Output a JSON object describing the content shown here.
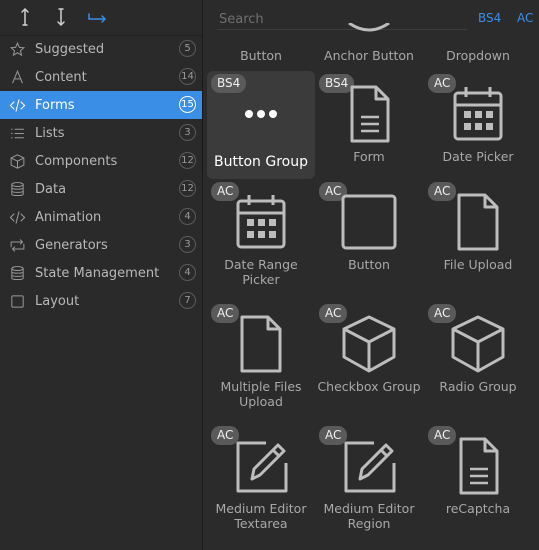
{
  "toolbar": {
    "tools": [
      "move-up-icon",
      "move-down-icon",
      "move-right-icon"
    ],
    "accent": "#3a8ee6"
  },
  "sidebar": {
    "items": [
      {
        "label": "Suggested",
        "count": "5",
        "icon": "star-icon"
      },
      {
        "label": "Content",
        "count": "14",
        "icon": "text-icon"
      },
      {
        "label": "Forms",
        "count": "15",
        "icon": "code-icon",
        "active": true
      },
      {
        "label": "Lists",
        "count": "3",
        "icon": "list-icon"
      },
      {
        "label": "Components",
        "count": "12",
        "icon": "cube-icon"
      },
      {
        "label": "Data",
        "count": "12",
        "icon": "database-icon"
      },
      {
        "label": "Animation",
        "count": "4",
        "icon": "code-icon"
      },
      {
        "label": "Generators",
        "count": "3",
        "icon": "loop-icon"
      },
      {
        "label": "State Management",
        "count": "4",
        "icon": "database-icon"
      },
      {
        "label": "Layout",
        "count": "7",
        "icon": "square-icon"
      }
    ]
  },
  "search": {
    "placeholder": "Search",
    "value": ""
  },
  "frameworks": {
    "bs4": "BS4",
    "ac": "AC"
  },
  "top_row_partial": [
    "Button",
    "Anchor Button",
    "Dropdown"
  ],
  "components": [
    {
      "name": "Button Group",
      "badge": "BS4",
      "icon": "dots-icon",
      "selected": true
    },
    {
      "name": "Form",
      "badge": "BS4",
      "icon": "document-icon"
    },
    {
      "name": "Date Picker",
      "badge": "AC",
      "icon": "calendar-icon"
    },
    {
      "name": "Date Range Picker",
      "badge": "AC",
      "icon": "calendar-icon"
    },
    {
      "name": "Button",
      "badge": "AC",
      "icon": "square-icon"
    },
    {
      "name": "File Upload",
      "badge": "AC",
      "icon": "file-icon"
    },
    {
      "name": "Multiple Files Upload",
      "badge": "AC",
      "icon": "file-icon"
    },
    {
      "name": "Checkbox Group",
      "badge": "AC",
      "icon": "cube-icon"
    },
    {
      "name": "Radio Group",
      "badge": "AC",
      "icon": "cube-icon"
    },
    {
      "name": "Medium Editor Textarea",
      "badge": "AC",
      "icon": "edit-icon"
    },
    {
      "name": "Medium Editor Region",
      "badge": "AC",
      "icon": "edit-icon"
    },
    {
      "name": "reCaptcha",
      "badge": "AC",
      "icon": "document-icon"
    }
  ]
}
